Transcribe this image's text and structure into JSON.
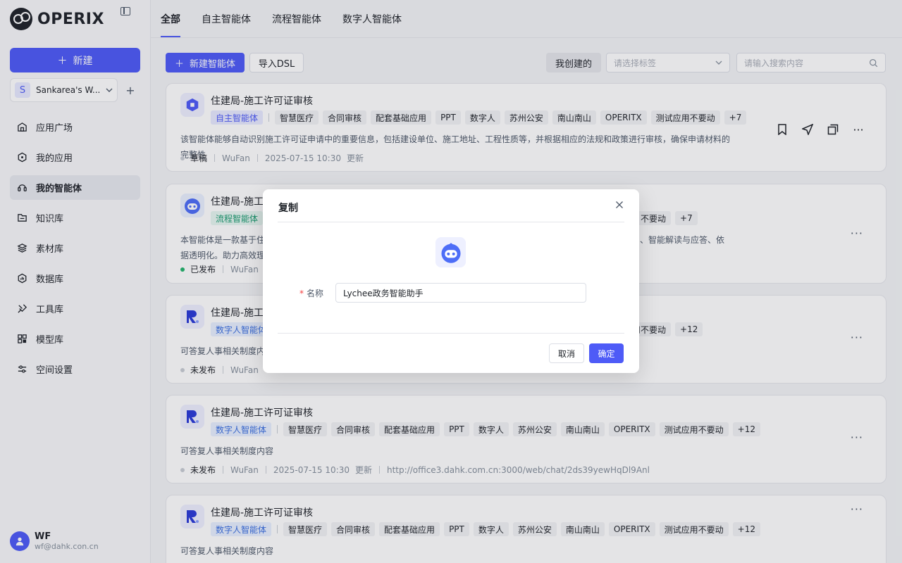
{
  "brand": {
    "name": "OPERIX"
  },
  "sidebar": {
    "new_label": "新建",
    "workspace": {
      "initial": "S",
      "name": "Sankarea's W..."
    },
    "items": [
      {
        "label": "应用广场",
        "icon": "plaza-icon"
      },
      {
        "label": "我的应用",
        "icon": "app-icon"
      },
      {
        "label": "我的智能体",
        "icon": "agent-icon"
      },
      {
        "label": "知识库",
        "icon": "knowledge-icon"
      },
      {
        "label": "素材库",
        "icon": "material-icon"
      },
      {
        "label": "数据库",
        "icon": "database-icon"
      },
      {
        "label": "工具库",
        "icon": "tool-icon"
      },
      {
        "label": "模型库",
        "icon": "model-icon"
      },
      {
        "label": "空间设置",
        "icon": "settings-icon"
      }
    ],
    "user": {
      "name": "WF",
      "email": "wf@dahk.con.cn"
    }
  },
  "tabs": [
    "全部",
    "自主智能体",
    "流程智能体",
    "数字人智能体"
  ],
  "toolbar": {
    "new_agent": "新建智能体",
    "import_dsl": "导入DSL",
    "created_by_me": "我创建的",
    "tag_placeholder": "请选择标签",
    "search_placeholder": "请输入搜索内容"
  },
  "cards": [
    {
      "title": "住建局-施工许可证审核",
      "type": "自主智能体",
      "tags": [
        "智慧医疗",
        "合同审核",
        "配套基础应用",
        "PPT",
        "数字人",
        "苏州公安",
        "南山南山",
        "OPERITX",
        "测试应用不要动"
      ],
      "more_tags": "+7",
      "desc": "该智能体能够自动识别施工许可证申请中的重要信息，包括建设单位、施工地址、工程性质等，并根据相应的法规和政策进行审核，确保申请材料的完整性",
      "status": "草稿",
      "author": "WuFan",
      "time": "2025-07-15 10:30",
      "updated": "更新"
    },
    {
      "title": "住建局-施工许",
      "type": "流程智能体",
      "tag_tail": "不要动",
      "more_tags": "+7",
      "desc_left": "本智能体是一款基于住建",
      "desc_right": "、智能解读与应答、依",
      "desc_line2": "据透明化。助力高效理解",
      "status": "已发布",
      "author": "WuFan"
    },
    {
      "title": "住建局-施工许",
      "type": "数字人智能体",
      "tag_tail": "用不要动",
      "more_tags": "+12",
      "desc": "可答复人事相关制度内容",
      "status": "未发布",
      "author": "WuFan"
    },
    {
      "title": "住建局-施工许可证审核",
      "type": "数字人智能体",
      "tags": [
        "智慧医疗",
        "合同审核",
        "配套基础应用",
        "PPT",
        "数字人",
        "苏州公安",
        "南山南山",
        "OPERITX",
        "测试应用不要动"
      ],
      "more_tags": "+12",
      "desc": "可答复人事相关制度内容",
      "status": "未发布",
      "author": "WuFan",
      "time": "2025-07-15 10:30",
      "updated": "更新",
      "url": "http://office3.dahk.com.cn:3000/web/chat/2ds39yewHqDl9Anl"
    },
    {
      "title": "住建局-施工许可证审核",
      "type": "数字人智能体",
      "tags": [
        "智慧医疗",
        "合同审核",
        "配套基础应用",
        "PPT",
        "数字人",
        "苏州公安",
        "南山南山",
        "OPERITX",
        "测试应用不要动"
      ],
      "more_tags": "+12",
      "desc": "可答复人事相关制度内容"
    }
  ],
  "modal": {
    "title": "复制",
    "name_label": "名称",
    "required_mark": "*",
    "name_value": "Lychee政务智能助手",
    "cancel": "取消",
    "ok": "确定"
  },
  "colors": {
    "primary": "#4e5bf7",
    "published": "#23b46b"
  }
}
